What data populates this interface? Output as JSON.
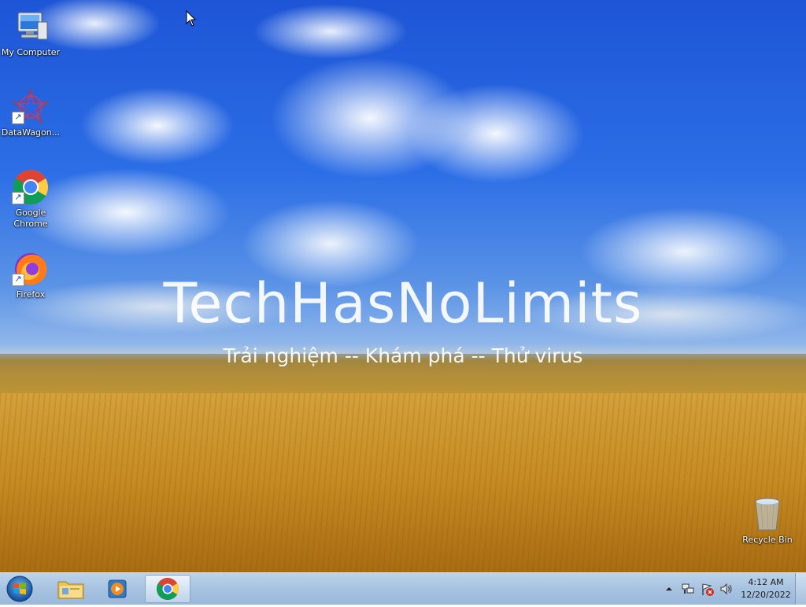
{
  "wallpaper": {
    "title": "TechHasNoLimits",
    "subtitle": "Trải nghiệm -- Khám phá -- Thử virus"
  },
  "desktop_icons": [
    {
      "label": "My Computer",
      "icon": "computer-icon"
    },
    {
      "label": "DataWagon...",
      "icon": "datawagon-icon"
    },
    {
      "label": "Google Chrome",
      "icon": "chrome-icon"
    },
    {
      "label": "Firefox",
      "icon": "firefox-icon"
    },
    {
      "label": "Recycle Bin",
      "icon": "recycle-bin-icon"
    }
  ],
  "taskbar": {
    "pinned": [
      {
        "name": "start-button",
        "icon": "windows-logo-icon"
      },
      {
        "name": "file-explorer",
        "icon": "folder-icon"
      },
      {
        "name": "media-player",
        "icon": "media-player-icon"
      },
      {
        "name": "chrome",
        "icon": "chrome-icon",
        "active": true
      }
    ],
    "tray_icons": [
      "show-hidden-icons",
      "network-icon",
      "action-center-icon",
      "volume-icon"
    ],
    "clock": {
      "time": "4:12 AM",
      "date": "12/20/2022"
    }
  },
  "colors": {
    "sky": "#2c6ee6",
    "field": "#c68a22",
    "taskbar": "#a9c4e2"
  }
}
